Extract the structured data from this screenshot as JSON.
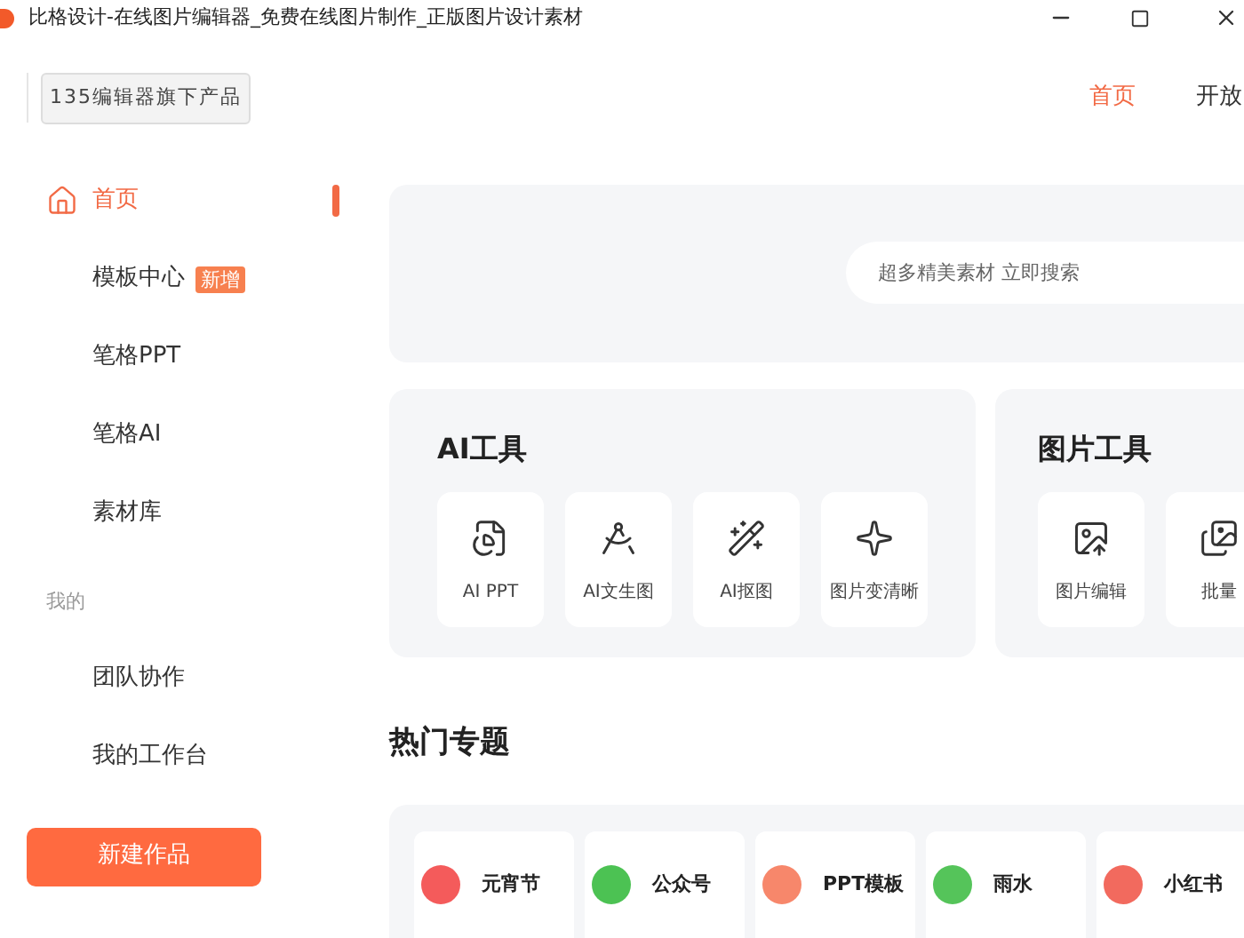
{
  "window": {
    "title": "比格设计-在线图片编辑器_免费在线图片制作_正版图片设计素材"
  },
  "header": {
    "brand_button": "135编辑器旗下产品",
    "nav": [
      {
        "label": "首页",
        "selected": true
      },
      {
        "label": "开放",
        "selected": false
      }
    ]
  },
  "sidebar": {
    "items": [
      {
        "label": "首页",
        "selected": true,
        "kind": "home"
      },
      {
        "label": "模板中心",
        "selected": false,
        "badge": "新增"
      },
      {
        "label": "笔格PPT",
        "selected": false
      },
      {
        "label": "笔格AI",
        "selected": false
      },
      {
        "label": "素材库",
        "selected": false
      }
    ],
    "section": "我的",
    "my_items": [
      {
        "label": "团队协作",
        "selected": false
      },
      {
        "label": "我的工作台",
        "selected": false
      }
    ],
    "new_button": "新建作品"
  },
  "search": {
    "placeholder": "超多精美素材 立即搜索"
  },
  "tool_groups": [
    {
      "title": "AI工具",
      "tools": [
        {
          "label": "AI PPT",
          "kind": "ppt"
        },
        {
          "label": "AI文生图",
          "kind": "compass"
        },
        {
          "label": "AI抠图",
          "kind": "wand"
        },
        {
          "label": "图片变清晰",
          "kind": "sparkle"
        }
      ]
    },
    {
      "title": "图片工具",
      "tools": [
        {
          "label": "图片编辑",
          "kind": "edit"
        },
        {
          "label": "批量",
          "kind": "batch"
        }
      ]
    }
  ],
  "topics": {
    "title": "热门专题",
    "items": [
      {
        "label": "元宵节",
        "color": "#f45b5b"
      },
      {
        "label": "公众号",
        "color": "#4cc253"
      },
      {
        "label": "PPT模板",
        "color": "#f7876b"
      },
      {
        "label": "雨水",
        "color": "#55c45a"
      },
      {
        "label": "小红书",
        "color": "#f26a5e"
      }
    ]
  }
}
